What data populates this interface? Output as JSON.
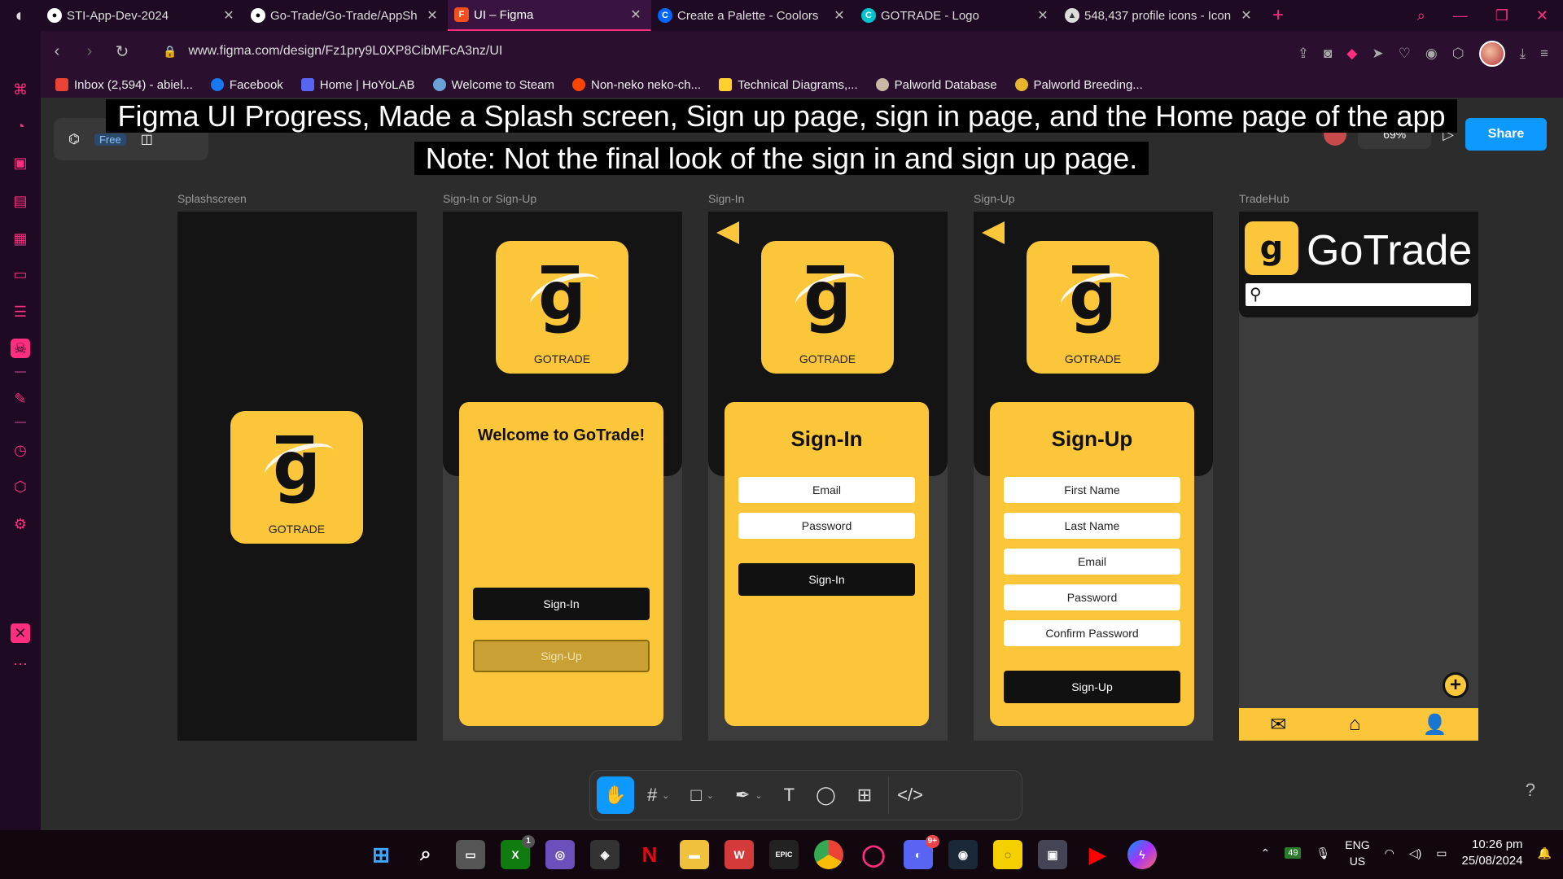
{
  "tabs": [
    {
      "title": "STI-App-Dev-2024",
      "icon": "github-icon",
      "active": false
    },
    {
      "title": "Go-Trade/Go-Trade/AppSh",
      "icon": "github-icon",
      "active": false
    },
    {
      "title": "UI – Figma",
      "icon": "figma-icon",
      "active": true
    },
    {
      "title": "Create a Palette - Coolors",
      "icon": "coolors-icon",
      "active": false
    },
    {
      "title": "GOTRADE - Logo",
      "icon": "canva-icon",
      "active": false
    },
    {
      "title": "548,437 profile icons - Icon",
      "icon": "flaticon-icon",
      "active": false
    }
  ],
  "address": {
    "url": "www.figma.com/design/Fz1pry9L0XP8CibMFcA3nz/UI"
  },
  "bookmarks": [
    "Inbox (2,594) - abiel...",
    "Facebook",
    "Home | HoYoLAB",
    "Welcome to Steam",
    "Non-neko neko-ch...",
    "Technical Diagrams,...",
    "Palworld Database",
    "Palworld Breeding..."
  ],
  "figma": {
    "share_label": "Share",
    "zoom": "69%",
    "plan_badge": "Free"
  },
  "caption": {
    "line1": "Figma UI Progress, Made a Splash screen, Sign up page, sign in page, and the Home page of the app",
    "line2": "Note: Not the final look of the sign in and sign up page."
  },
  "frames": {
    "splash": {
      "label": "Splashscreen",
      "logo_text": "GOTRADE"
    },
    "choice": {
      "label": "Sign-In or Sign-Up",
      "logo_text": "GOTRADE",
      "heading": "Welcome to GoTrade!",
      "signin_btn": "Sign-In",
      "signup_btn": "Sign-Up"
    },
    "signin": {
      "label": "Sign-In",
      "logo_text": "GOTRADE",
      "heading": "Sign-In",
      "email": "Email",
      "password": "Password",
      "submit": "Sign-In"
    },
    "signup": {
      "label": "Sign-Up",
      "logo_text": "GOTRADE",
      "heading": "Sign-Up",
      "first_name": "First Name",
      "last_name": "Last Name",
      "email": "Email",
      "password": "Password",
      "confirm": "Confirm Password",
      "submit": "Sign-Up"
    },
    "home": {
      "label": "TradeHub",
      "app_name": "GoTrade"
    }
  },
  "taskbar": {
    "lang_top": "ENG",
    "lang_bottom": "US",
    "time": "10:26 pm",
    "date": "25/08/2024",
    "xbox_badge": "1",
    "discord_badge": "9+",
    "tray_badge": "49"
  },
  "colors": {
    "brand_yellow": "#fcc63a",
    "figma_blue": "#0d99ff",
    "opera_accent": "#ff2e7e"
  }
}
